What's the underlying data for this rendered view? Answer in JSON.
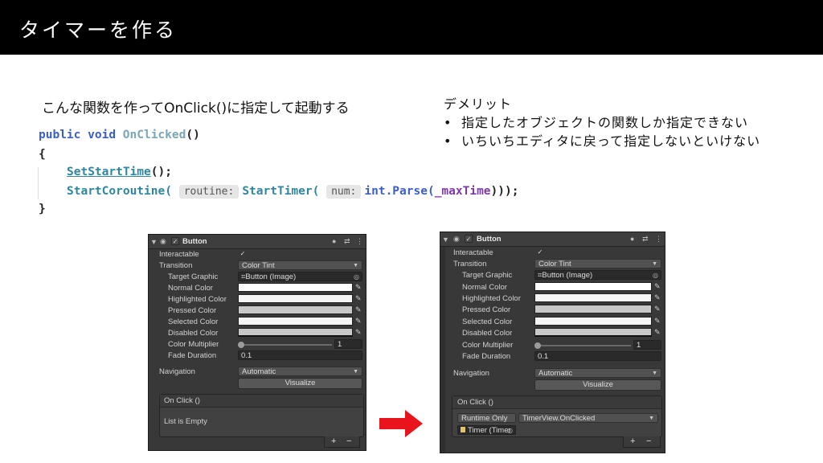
{
  "title": "タイマーを作る",
  "caption": "こんな関数を作ってOnClick()に指定して起動する",
  "demerit": {
    "heading": "デメリット",
    "bullet": "•",
    "items": [
      "指定したオブジェクトの関数しか指定できない",
      "いちいちエディタに戻って指定しないといけない"
    ]
  },
  "code": {
    "kw_public": "public",
    "kw_void": "void",
    "method_name": "OnClicked",
    "parens": "()",
    "open_brace": "{",
    "close_brace": "}",
    "call1": "SetStartTime",
    "call1_tail": "();",
    "call2": "StartCoroutine(",
    "hint_routine": "routine:",
    "call3": "StartTimer(",
    "hint_num": "num:",
    "parse": "int.Parse(",
    "field": "_maxTime",
    "call_tail": ")));"
  },
  "inspector": {
    "component": "Button",
    "interactable_label": "Interactable",
    "interactable_checked": "✓",
    "transition_label": "Transition",
    "transition_value": "Color Tint",
    "target_graphic_label": "Target Graphic",
    "target_graphic_value": "Button (Image)",
    "normal_color_label": "Normal Color",
    "highlighted_color_label": "Highlighted Color",
    "pressed_color_label": "Pressed Color",
    "selected_color_label": "Selected Color",
    "disabled_color_label": "Disabled Color",
    "color_multiplier_label": "Color Multiplier",
    "color_multiplier_value": "1",
    "fade_duration_label": "Fade Duration",
    "fade_duration_value": "0.1",
    "navigation_label": "Navigation",
    "navigation_value": "Automatic",
    "visualize_label": "Visualize",
    "onclick_label": "On Click ()",
    "plus": "+",
    "minus": "−",
    "colors": {
      "normal": "#ffffff",
      "highlighted": "#f5f5f5",
      "pressed": "#c8c8c8",
      "selected": "#f5f5f5",
      "disabled": "#c8c8c8"
    }
  },
  "left_event": {
    "empty_text": "List is Empty"
  },
  "right_event": {
    "runtime_value": "Runtime Only",
    "function_value": "TimerView.OnClicked",
    "object_value": "Timer (Timer"
  },
  "arrow_color": "#e8131b"
}
